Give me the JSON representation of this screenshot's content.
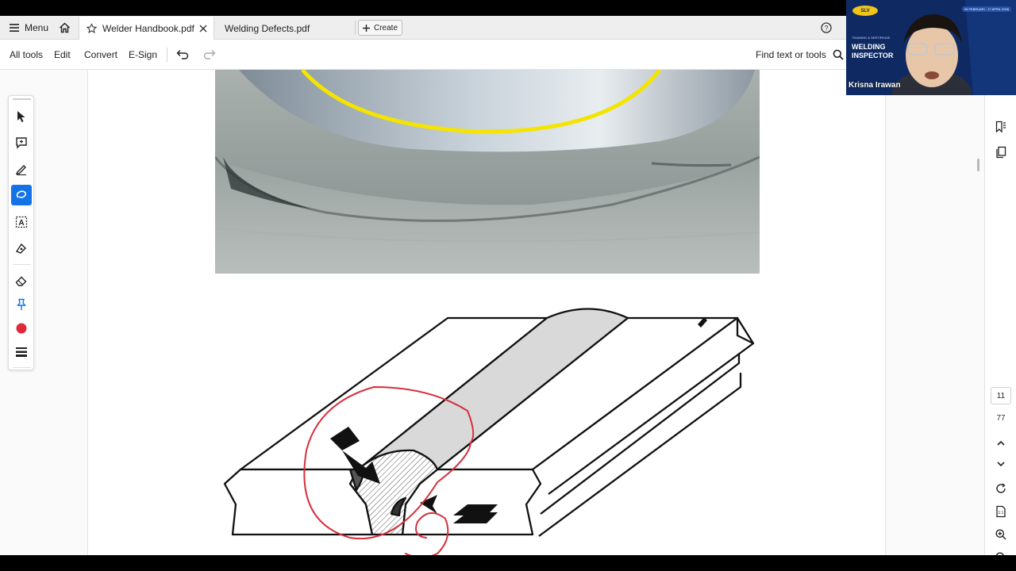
{
  "tabbar": {
    "menu_label": "Menu",
    "tabs": [
      {
        "label": "Welder Handbook.pdf",
        "active": true
      },
      {
        "label": "Welding Defects.pdf",
        "active": false
      }
    ],
    "create_label": "Create"
  },
  "toolbar": {
    "all_tools": "All tools",
    "edit": "Edit",
    "convert": "Convert",
    "esign": "E-Sign",
    "find_label": "Find text or tools"
  },
  "left_tools": [
    {
      "icon": "cursor-icon"
    },
    {
      "icon": "add-comment-icon"
    },
    {
      "icon": "highlight-pen-icon"
    },
    {
      "icon": "lasso-draw-icon",
      "selected": true
    },
    {
      "icon": "text-box-icon"
    },
    {
      "icon": "draw-shape-icon"
    },
    {
      "icon": "eraser-icon"
    },
    {
      "icon": "pin-icon"
    },
    {
      "icon": "color-dot-icon",
      "color": "#e0283c"
    },
    {
      "icon": "line-weight-icon"
    }
  ],
  "navigation": {
    "current_page": "11",
    "total_pages": "77"
  },
  "webcam": {
    "logo": "SLV",
    "dates": "09 FEBRUARI - 17 APRIL 2026",
    "header": "TRAINING & SERTIFIKASI",
    "title_line1": "WELDING",
    "title_line2": "INSPECTOR",
    "name": "Krisna Irawan"
  },
  "colors": {
    "accent": "#1473e6",
    "annotation_red": "#d62f3b",
    "annotation_yellow": "#f4e400"
  }
}
